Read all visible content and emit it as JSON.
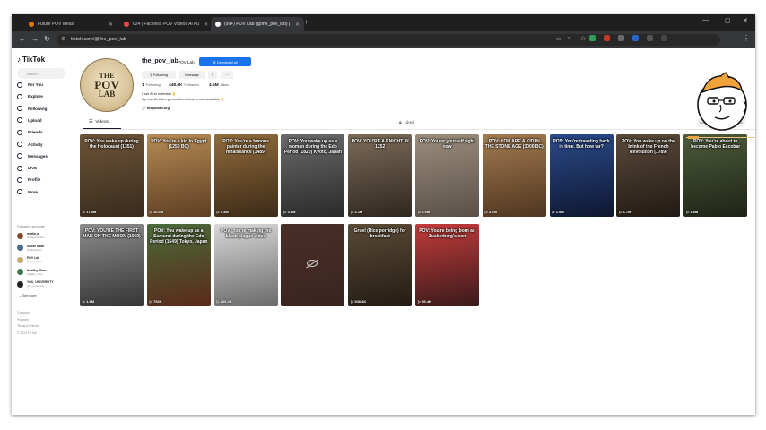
{
  "browser": {
    "tabs": [
      {
        "title": "Future POV Ideas",
        "color": "#e37400",
        "active": false
      },
      {
        "title": "624 | Faceless POV Videos AI Au",
        "color": "#ff4040",
        "active": false
      },
      {
        "title": "(99+) POV Lab (@the_pov_lab) | Ti",
        "color": "#ffffff",
        "active": true
      }
    ],
    "new_tab": "+",
    "url": "tiktok.com/@the_pov_lab",
    "nav_back": "←",
    "nav_forward": "→",
    "nav_reload": "↻"
  },
  "sidebar": {
    "brand": "TikTok",
    "search_placeholder": "Search",
    "items": [
      {
        "label": "For You",
        "active": false
      },
      {
        "label": "Explore",
        "active": false
      },
      {
        "label": "Following",
        "active": false
      },
      {
        "label": "Upload",
        "active": false
      },
      {
        "label": "Friends",
        "active": false
      },
      {
        "label": "Activity",
        "active": false
      },
      {
        "label": "Messages",
        "active": false
      },
      {
        "label": "LIVE",
        "active": false
      },
      {
        "label": "Profile",
        "active": false
      },
      {
        "label": "More",
        "active": false
      }
    ],
    "following_title": "Following accounts",
    "accounts": [
      {
        "name": "martin.ai",
        "handle": "chatgptmartinn",
        "color": "#7a4a2a"
      },
      {
        "name": "Sande Allan",
        "handle": "SHilethiannn",
        "color": "#4a6a8a"
      },
      {
        "name": "POV Lab",
        "handle": "the_pov_lab",
        "color": "#c9a86a"
      },
      {
        "name": "Healthy Films",
        "handle": "healthy_films",
        "color": "#3a7a4a"
      },
      {
        "name": "YOU_UNIVERSITY",
        "handle": "you_university",
        "color": "#222222"
      }
    ],
    "see_more": "See more",
    "footer": [
      "Company",
      "Program",
      "Terms & Policies",
      "© 2024 TikTok"
    ]
  },
  "profile": {
    "avatar_lines": [
      "THE",
      "POV",
      "LAB"
    ],
    "username": "the_pov_lab",
    "nickname": "POV Lab",
    "download_button": "⊕ Download all",
    "following_button": "⚲ Following",
    "message_button": "Message",
    "share_icon": "share-icon",
    "more_icon": "more-icon",
    "stats": [
      {
        "value": "1",
        "label": "Following"
      },
      {
        "value": "448.9K",
        "label": "Followers"
      },
      {
        "value": "4.5M",
        "label": "Likes"
      }
    ],
    "bio": [
      "I use AI to entertain 👌",
      "My own AI video generation course is now available 👇"
    ],
    "link": "🔗 thepovlab.org"
  },
  "content_tabs": {
    "videos": "Videos",
    "liked": "Liked",
    "sort": [
      "Latest",
      "Popular",
      "Oldest"
    ],
    "sort_selected": "Popular"
  },
  "videos": [
    {
      "caption": "POV: You wake up during the Holocaust (1351)",
      "views": "17.5M",
      "colors": [
        "#6d5438",
        "#3a2b1d"
      ]
    },
    {
      "caption": "POV: You're a kid in Egypt (1250 BC)",
      "views": "10.4M",
      "colors": [
        "#b58a55",
        "#5e3f22"
      ]
    },
    {
      "caption": "POV: You're a famous painter during the renaissance (1489)",
      "views": "5.4M",
      "colors": [
        "#8f6b3c",
        "#3d2a17"
      ]
    },
    {
      "caption": "POV: You wake up as a woman during the Edo Period (1820) Kyoto, Japan",
      "views": "3.8M",
      "colors": [
        "#6a6a6a",
        "#2a2a2a"
      ]
    },
    {
      "caption": "POV: YOU'RE A KNIGHT IN 1252",
      "views": "3.1M",
      "colors": [
        "#7c6b58",
        "#2e2720"
      ]
    },
    {
      "caption": "POV: You're yourself right now",
      "views": "2.9M",
      "colors": [
        "#9a8d7c",
        "#5a5048"
      ]
    },
    {
      "caption": "POV: YOU ARE A KID IN THE STONE AGE (3000 BC)",
      "views": "2.7M",
      "colors": [
        "#a27b50",
        "#4f3520"
      ]
    },
    {
      "caption": "POV: You're traveling back in time. But how far?",
      "views": "1.9M",
      "colors": [
        "#2b4a8a",
        "#0d1730"
      ]
    },
    {
      "caption": "POV: You wake up on the brink of the French Revolution (1789)",
      "views": "1.7M",
      "colors": [
        "#5a4a3a",
        "#211a14"
      ]
    },
    {
      "caption": "POV: You're about to become Pablo Escobar",
      "views": "1.6M",
      "colors": [
        "#4d5a3a",
        "#1e2416"
      ]
    },
    {
      "caption": "POV: YOU'RE THE FIRST MAN ON THE MOON (1969)",
      "views": "1.6M",
      "colors": [
        "#8c8c8c",
        "#353535"
      ]
    },
    {
      "caption": "POV: You wake up as a Samurai during the Edo Period (1649) Tokyo, Japan",
      "views": "753K",
      "colors": [
        "#4a6a3a",
        "#5a2a1a"
      ]
    },
    {
      "caption": "POV: You're making the black plague video",
      "views": "206.2K",
      "colors": [
        "#d8d8d8",
        "#6a6a6a"
      ]
    },
    {
      "caption": "",
      "views": "",
      "colors": [
        "#4a2e28",
        "#3a2420"
      ],
      "hidden": true
    },
    {
      "caption": "Gruel (Rice porridge) for breakfast",
      "views": "536.4K",
      "colors": [
        "#5a4a35",
        "#231c14"
      ]
    },
    {
      "caption": "POV: You're being born as Zuckerberg's son",
      "views": "35.4K",
      "colors": [
        "#c23b3b",
        "#3a1a1a"
      ]
    }
  ]
}
